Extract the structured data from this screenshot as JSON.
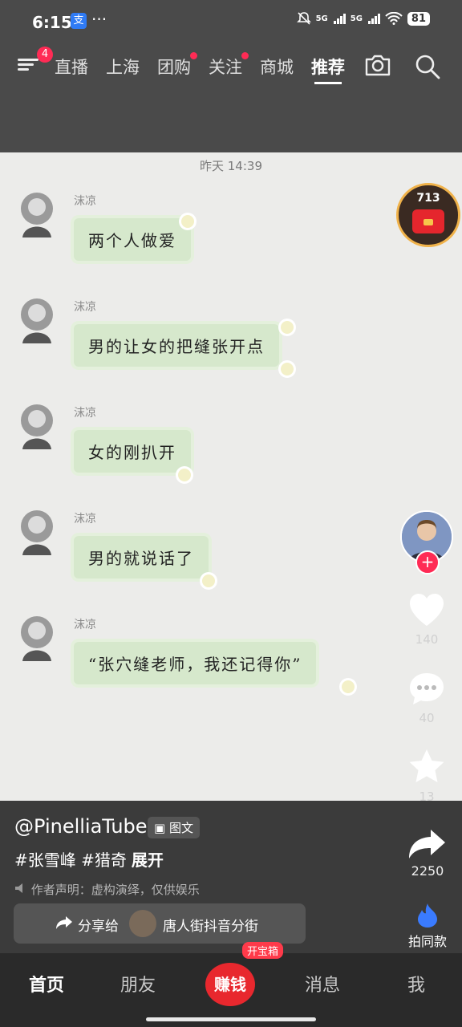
{
  "status": {
    "time": "6:15",
    "app_icon_label": "支",
    "dots": "···",
    "battery": "81",
    "signal1": "5G",
    "signal2": "5G"
  },
  "top_nav": {
    "badge": "4",
    "tabs": [
      {
        "label": "直播"
      },
      {
        "label": "上海"
      },
      {
        "label": "团购"
      },
      {
        "label": "关注"
      },
      {
        "label": "商城"
      },
      {
        "label": "推荐"
      }
    ]
  },
  "chat": {
    "timestamp": "昨天 14:39",
    "messages": [
      {
        "sender": "沫凉",
        "text": "两个人做爱"
      },
      {
        "sender": "沫凉",
        "text": "男的让女的把缝张开点"
      },
      {
        "sender": "沫凉",
        "text": "女的刚扒开"
      },
      {
        "sender": "沫凉",
        "text": "男的就说话了"
      },
      {
        "sender": "沫凉",
        "text": "“张穴缝老师，我还记得你”"
      }
    ]
  },
  "rail": {
    "hongbao_count": "713",
    "likes": "140",
    "comments": "40",
    "favorites": "13",
    "shares": "2250",
    "same_label": "拍同款"
  },
  "info": {
    "author": "@PinelliaTuber",
    "tuwen": "图文",
    "tags": "#张雪峰 #猎奇",
    "expand": "展开",
    "disclaimer": "作者声明：虚构演绎，仅供娱乐",
    "share_label": "分享给",
    "share_target": "唐人街抖音分街"
  },
  "bottom_nav": {
    "home": "首页",
    "friends": "朋友",
    "earn": "赚钱",
    "earn_tag": "开宝箱",
    "messages": "消息",
    "me": "我"
  }
}
